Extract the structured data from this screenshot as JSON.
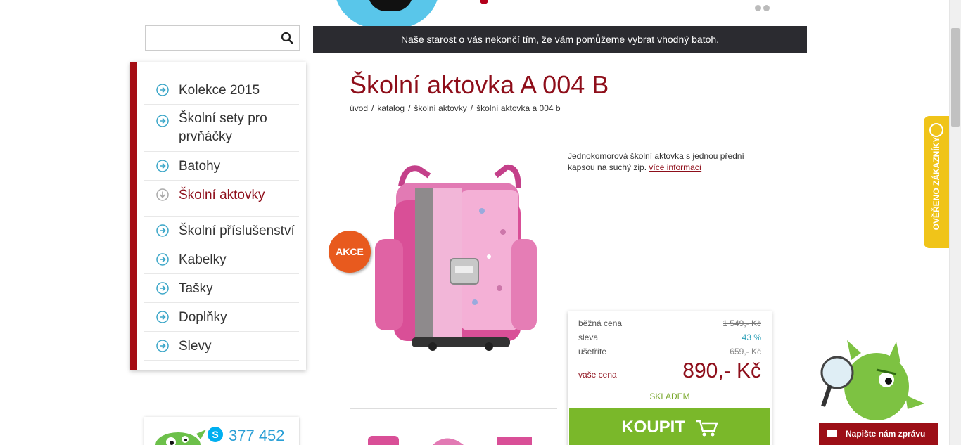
{
  "header": {
    "banner_text": "Naše starost o vás nekončí tím, že vám pomůžeme vybrat vhodný batoh."
  },
  "search": {
    "placeholder": "",
    "value": "",
    "icon": "search-icon"
  },
  "sidebar": {
    "accent_color": "#a50d14",
    "items": [
      {
        "label": "Kolekce 2015",
        "icon": "arrow-right-circle-icon"
      },
      {
        "label": "Školní sety pro prvňáčky",
        "icon": "arrow-right-circle-icon"
      },
      {
        "label": "Batohy",
        "icon": "arrow-right-circle-icon"
      },
      {
        "label": "Školní aktovky",
        "icon": "arrow-down-circle-icon",
        "active": true
      },
      {
        "label": "Školní příslušenství",
        "icon": "arrow-right-circle-icon"
      },
      {
        "label": "Kabelky",
        "icon": "arrow-right-circle-icon"
      },
      {
        "label": "Tašky",
        "icon": "arrow-right-circle-icon"
      },
      {
        "label": "Doplňky",
        "icon": "arrow-right-circle-icon"
      },
      {
        "label": "Slevy",
        "icon": "arrow-right-circle-icon"
      }
    ]
  },
  "contact": {
    "phone": "377 452"
  },
  "product": {
    "title": "Školní aktovka A 004 B",
    "badge": "AKCE",
    "description": "Jednokomorová školní aktovka s jednou přední kapsou na suchý zip.",
    "more_link": "více informací"
  },
  "breadcrumb": {
    "items": [
      "úvod",
      "katalog",
      "školní aktovky"
    ],
    "current": "školní aktovka a 004 b"
  },
  "price": {
    "regular_label": "běžná cena",
    "regular_value": "1 549,- Kč",
    "discount_label": "sleva",
    "discount_value": "43 %",
    "save_label": "ušetříte",
    "save_value": "659,- Kč",
    "your_label": "vaše cena",
    "your_value": "890,- Kč",
    "stock": "SKLADEM",
    "buy_label": "KOUPIT"
  },
  "verified": {
    "label": "OVĚŘENO ZÁKAZNÍKY"
  },
  "chat": {
    "label": "Napište nám zprávu"
  },
  "colors": {
    "brand_red": "#8e0e1a",
    "buy_green": "#7ab82a",
    "banner_dark": "#2b2b30",
    "verified_yellow": "#f0c419"
  }
}
